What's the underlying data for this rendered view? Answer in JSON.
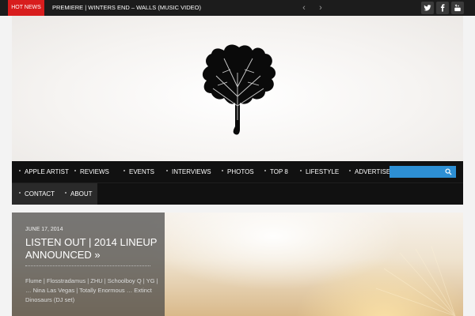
{
  "topbar": {
    "hot_news_label": "HOT NEWS",
    "ticker_text": "PREMIERE | WINTERS END – WALLS (MUSIC VIDEO)",
    "prev_arrow": "‹",
    "next_arrow": "›",
    "social_icons": [
      "twitter-icon",
      "facebook-icon",
      "youtube-icon"
    ]
  },
  "nav": {
    "row1": [
      "APPLE ARTIST",
      "REVIEWS",
      "EVENTS",
      "INTERVIEWS",
      "PHOTOS",
      "TOP 8",
      "LIFESTYLE",
      "ADVERTISE"
    ],
    "row2": [
      "CONTACT",
      "ABOUT"
    ],
    "search_placeholder": "",
    "search_icon": "search-icon"
  },
  "slider": {
    "date": "JUNE 17, 2014",
    "title": "LISTEN OUT | 2014 LINEUP ANNOUNCED »",
    "excerpt": "Flume | Flosstradamus | ZHU | Schoolboy Q | YG | … Nina Las Vegas | Totally Enormous … Extinct Dinosaurs (DJ set)"
  },
  "colors": {
    "hot_news": "#d81d1d",
    "search": "#2d8fd4",
    "nav_bg": "#111111",
    "topbar_bg": "#1c1c1c"
  }
}
